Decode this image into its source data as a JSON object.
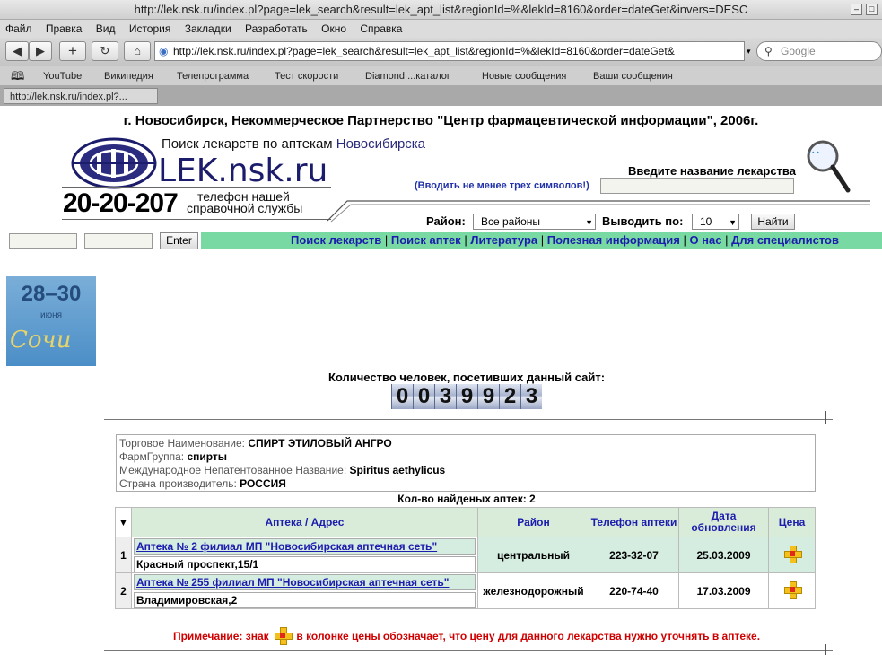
{
  "window": {
    "title": "http://lek.nsk.ru/index.pl?page=lek_search&result=lek_apt_list&regionId=%&lekId=8160&order=dateGet&invers=DESC"
  },
  "menu": [
    "Файл",
    "Правка",
    "Вид",
    "История",
    "Закладки",
    "Разработать",
    "Окно",
    "Справка"
  ],
  "toolbar": {
    "url": "http://lek.nsk.ru/index.pl?page=lek_search&result=lek_apt_list&regionId=%&lekId=8160&order=dateGet&",
    "search_placeholder": "Google"
  },
  "bookmarks": [
    "YouTube",
    "Википедия",
    "Телепрограмма",
    "Тест скорости",
    "Diamond ...каталог",
    "Новые сообщения",
    "Ваши сообщения"
  ],
  "tab": {
    "label": "http://lek.nsk.ru/index.pl?..."
  },
  "page": {
    "header": "г. Новосибирск, Некоммерческое Партнерство \"Центр фармацевтической информации\", 2006г.",
    "subtitle_prefix": "Поиск лекарств по аптекам",
    "subtitle_city": "Новосибирска",
    "site_name": "LEK.nsk.ru",
    "phone": "20-20-207",
    "phone_label_1": "телефон нашей",
    "phone_label_2": "справочной службы",
    "drug_label": "Введите название лекарства",
    "drug_hint": "(Вводить не менее трех символов!)",
    "region_label": "Район:",
    "region_value": "Все районы",
    "per_page_label": "Выводить по:",
    "per_page_value": "10",
    "find_button": "Найти",
    "enter_button": "Enter",
    "nav": [
      "Поиск лекарств",
      "Поиск аптек",
      "Литература",
      "Полезная информация",
      "О нас",
      "Для специалистов"
    ],
    "banner_dates": "28–30",
    "banner_month": "июня",
    "banner_city": "Сочи",
    "counter_label": "Количество человек, посетивших данный сайт:",
    "counter_digits": [
      "0",
      "0",
      "3",
      "9",
      "9",
      "2",
      "3"
    ],
    "info": {
      "trade_name_label": "Торговое Наименование:",
      "trade_name": "СПИРТ ЭТИЛОВЫЙ АНГРО",
      "pharm_group_label": "ФармГруппа:",
      "pharm_group": "спирты",
      "inn_label": "Международное Непатентованное Название:",
      "inn": "Spiritus aethylicus",
      "country_label": "Страна производитель:",
      "country": "РОССИЯ"
    },
    "found_label": "Кол-во найденых аптек: 2",
    "table_headers": [
      "Аптека / Адрес",
      "Район",
      "Телефон аптеки",
      "Дата обновления",
      "Цена"
    ],
    "rows": [
      {
        "num": "1",
        "name": "Аптека № 2 филиал МП \"Новосибирская аптечная сеть\"",
        "address": "Красный проспект,15/1",
        "district": "центральный",
        "phone": "223-32-07",
        "date": "25.03.2009"
      },
      {
        "num": "2",
        "name": "Аптека № 255 филиал МП \"Новосибирская аптечная сеть\"",
        "address": "Владимировская,2",
        "district": "железнодорожный",
        "phone": "220-74-40",
        "date": "17.03.2009"
      }
    ],
    "note_prefix": "Примечание: знак",
    "note_suffix": "в колонке цены обозначает, что цену для данного лекарства нужно уточнять в аптеке."
  }
}
